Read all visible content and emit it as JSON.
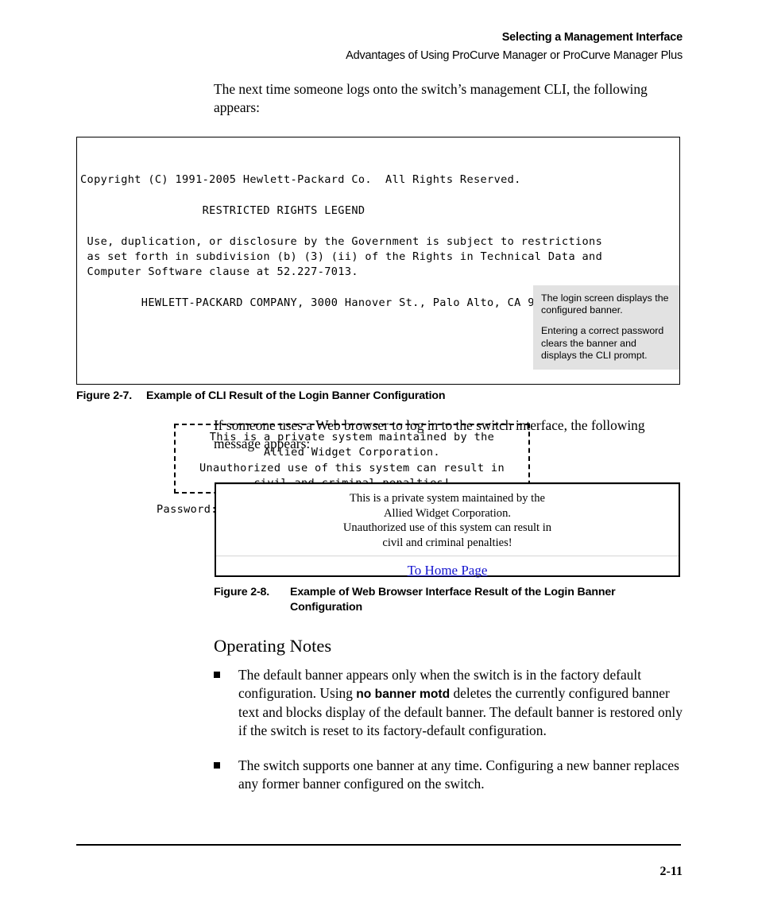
{
  "header": {
    "title": "Selecting a Management Interface",
    "subtitle": "Advantages of Using ProCurve Manager or ProCurve Manager Plus"
  },
  "intro_paragraph": "The next time someone logs onto the switch’s management CLI, the following appears:",
  "cli_figure": {
    "screen_text": "Copyright (C) 1991-2005 Hewlett-Packard Co.  All Rights Reserved.\n\n                  RESTRICTED RIGHTS LEGEND\n\n Use, duplication, or disclosure by the Government is subject to restrictions\n as set forth in subdivision (b) (3) (ii) of the Rights in Technical Data and\n Computer Software clause at 52.227-7013.\n\n         HEWLETT-PACKARD COMPANY, 3000 Hanover St., Palo Alto, CA 94303",
    "banner_text": "This is a private system maintained by the\nAllied Widget Corporation.\nUnauthorized use of this system can result in\ncivil and criminal penalties!",
    "password_prompt": "Password: ",
    "callout": {
      "paragraph_1": "The login screen displays the configured banner.",
      "paragraph_2": "Entering a correct password clears the banner and displays the CLI prompt.",
      "background_color": "#e2e2e2"
    }
  },
  "figure_2_7_caption": {
    "label": "Figure 2-7.",
    "title": "Example of CLI Result of the Login Banner Configuration"
  },
  "web_intro_paragraph": "If someone uses a Web browser to log in to the switch interface, the following message appears:",
  "web_figure": {
    "line_1": "This is a private system maintained by the",
    "line_2": "Allied Widget Corporation.",
    "line_3": "Unauthorized use of this system can result in",
    "line_4": "civil and criminal penalties!",
    "link_label": "To Home Page",
    "link_color": "#1414d0"
  },
  "figure_2_8_caption": {
    "label": "Figure 2-8.",
    "title": "Example of Web Browser Interface Result of the Login Banner Configuration"
  },
  "operating_notes": {
    "heading": "Operating Notes",
    "bullets": [
      {
        "text_before": "The default banner appears only when the switch is in the factory default configuration. Using ",
        "command": "no banner motd",
        "text_after": " deletes the currently configured banner text and blocks display of the default banner. The default banner is restored only if the switch is reset to its factory-default configuration."
      },
      {
        "text_before": "The switch supports one banner at any time. Configuring a new banner replaces any former banner configured on the switch.",
        "command": "",
        "text_after": ""
      }
    ]
  },
  "footer": {
    "page_number": "2-11"
  }
}
